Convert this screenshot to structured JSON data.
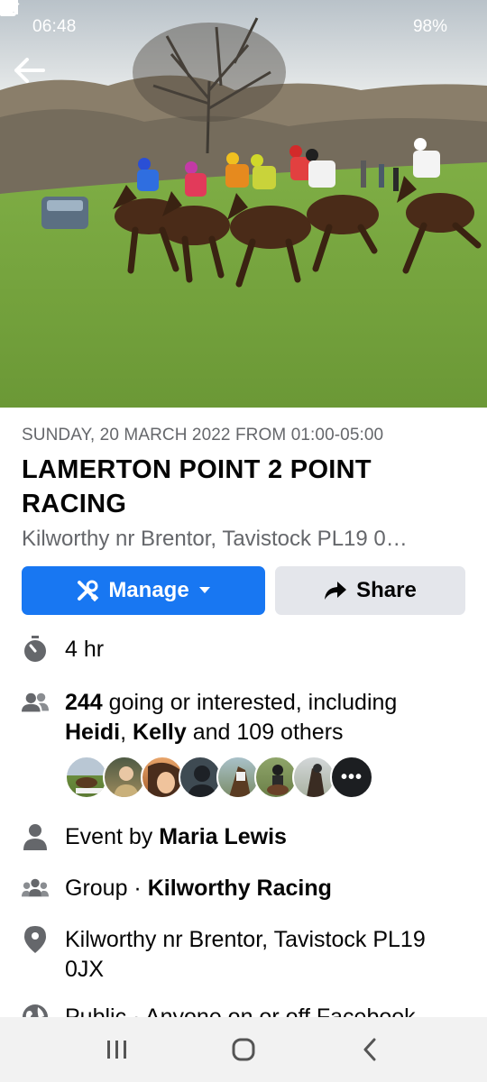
{
  "status": {
    "time": "06:48",
    "battery": "98%",
    "left_icons": [
      "cloud-icon",
      "mail-icon",
      "image-icon"
    ],
    "right_icons": [
      "wifi-icon",
      "signal-icon",
      "battery-icon"
    ]
  },
  "event": {
    "date_line": "SUNDAY, 20 MARCH 2022 FROM 01:00-05:00",
    "title": "LAMERTON POINT 2 POINT RACING",
    "location_short": "Kilworthy nr Brentor, Tavistock PL19 0…"
  },
  "buttons": {
    "manage": "Manage",
    "share": "Share"
  },
  "details": {
    "duration": "4 hr",
    "attendance_count": "244",
    "attendance_text": " going or interested, including",
    "attendee_1": "Heidi",
    "attendee_sep": ", ",
    "attendee_2": "Kelly",
    "attendance_tail": " and 109 others",
    "more_avatars": "•••",
    "event_by_prefix": "Event by ",
    "event_by_name": "Maria Lewis",
    "group_prefix": "Group · ",
    "group_name": "Kilworthy Racing",
    "address": "Kilworthy nr Brentor, Tavistock PL19 0JX",
    "privacy": "Public · Anyone on or off Facebook"
  },
  "colors": {
    "accent": "#1877f2",
    "secondary_button": "#e4e6eb",
    "muted_text": "#65676b",
    "icon_gray": "#8a8d91"
  }
}
